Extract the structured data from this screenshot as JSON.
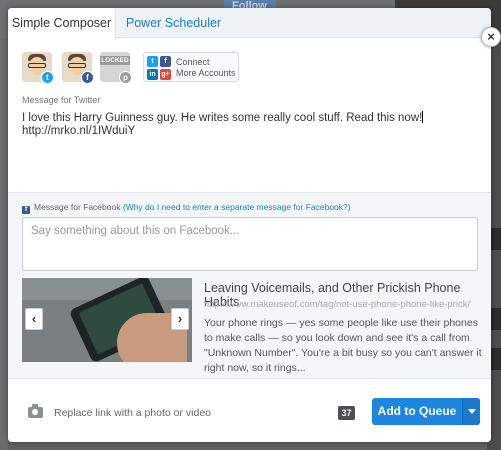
{
  "background": {
    "follow_label": "Follow"
  },
  "tabs": [
    {
      "label": "Simple Composer",
      "active": true
    },
    {
      "label": "Power Scheduler",
      "active": false
    }
  ],
  "close_label": "×",
  "profiles": {
    "locked_label": "LOCKED",
    "connect_line1": "Connect",
    "connect_line2": "More Accounts"
  },
  "twitter": {
    "label": "Message for Twitter",
    "message_line1": "I love this Harry Guinness guy. He writes some really cool stuff. Read this now!",
    "message_line2": "http://mrko.nl/1IWduiY"
  },
  "facebook": {
    "label": "Message for Facebook",
    "why_link": "(Why do I need to enter a separate message for Facebook?)",
    "placeholder": "Say something about this on Facebook..."
  },
  "link_preview": {
    "title": "Leaving Voicemails, and Other Prickish Phone Habits",
    "url": "http://www.makeuseof.com/tag/not-use-phone-phone-like-prick/",
    "description": "Your phone rings — yes some people like use their phones to make calls — so you look down and see it's a call from \"Unknown Number\". You're a bit busy so you can't answer it right now, so it rings...",
    "prev": "‹",
    "next": "›"
  },
  "footer": {
    "replace_label": "Replace link with a photo or video",
    "char_count": "37",
    "add_button": "Add to Queue"
  },
  "colors": {
    "accent": "#1f86df",
    "link": "#1a7ed0",
    "twitter": "#1da1f2",
    "facebook": "#3b5998"
  }
}
